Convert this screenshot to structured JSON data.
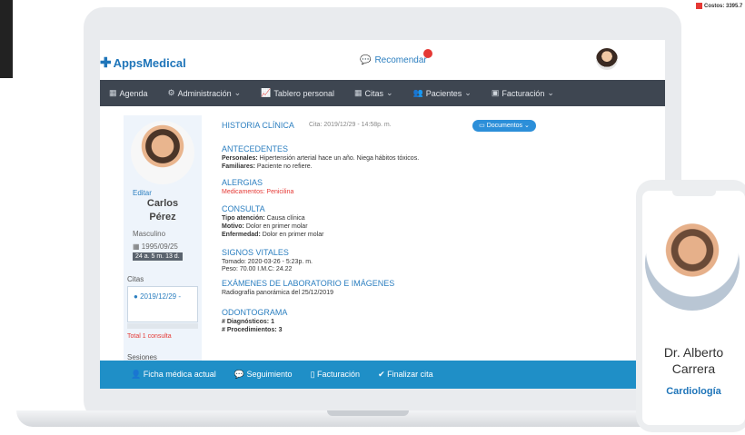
{
  "header": {
    "logo": "AppsMedical",
    "recommend": "Recomendar"
  },
  "nav": {
    "items": [
      {
        "icon": "calendar-icon",
        "label": "Agenda"
      },
      {
        "icon": "gears-icon",
        "label": "Administración"
      },
      {
        "icon": "chart-icon",
        "label": "Tablero personal"
      },
      {
        "icon": "calendar-icon",
        "label": "Citas"
      },
      {
        "icon": "users-icon",
        "label": "Pacientes"
      },
      {
        "icon": "money-icon",
        "label": "Facturación"
      }
    ]
  },
  "sidebar": {
    "edit": "Editar",
    "first_name": "Carlos",
    "last_name": "Pérez",
    "gender": "Masculino",
    "birth": "1995/09/25",
    "age": "24 a. 5 m. 13 d.",
    "citas_title": "Citas",
    "cita_item": "2019/12/29 -",
    "total": "Total 1 consulta",
    "sesiones": "Sesiones"
  },
  "record": {
    "title": "HISTORIA CLÍNICA",
    "date": "Cita: 2019/12/29 - 14:58p. m.",
    "docs": "Documentos",
    "antecedentes": "ANTECEDENTES",
    "personales_label": "Personales:",
    "personales_value": "Hipertensión arterial hace un año. Niega hábitos tóxicos.",
    "familiares_label": "Familiares:",
    "familiares_value": "Paciente no refiere.",
    "alergias": "ALERGIAS",
    "alergias_value": "Medicamentos: Penicilina",
    "consulta": "CONSULTA",
    "tipo_label": "Tipo atención:",
    "tipo_value": "Causa clínica",
    "motivo_label": "Motivo:",
    "motivo_value": "Dolor en primer molar",
    "enfermedad_label": "Enfermedad:",
    "enfermedad_value": "Dolor en primer molar",
    "signos": "SIGNOS VITALES",
    "tomado": "Tomado: 2020-03-26 - 5:23p. m.",
    "peso": "Peso: 70.00       I.M.C: 24.22",
    "examenes": "EXÁMENES DE LABORATORIO E IMÁGENES",
    "examenes_value": "Radiografía panorámica del 25/12/2019",
    "odontograma": "ODONTOGRAMA",
    "diagnosticos": "# Diagnósticos: 1",
    "procedimientos": "# Procedimientos: 3"
  },
  "footer": {
    "items": [
      "Ficha médica actual",
      "Seguimiento",
      "Facturación",
      "Finalizar cita"
    ]
  },
  "phone": {
    "doctor_first": "Dr. Alberto",
    "doctor_last": "Carrera",
    "specialty": "Cardiología"
  },
  "badge": {
    "costos": "Costos: 3395.7"
  },
  "colors": {
    "accent": "#1f75b9",
    "navbar": "#3e4651",
    "footer": "#1f8fc7",
    "alert": "#e53935"
  }
}
